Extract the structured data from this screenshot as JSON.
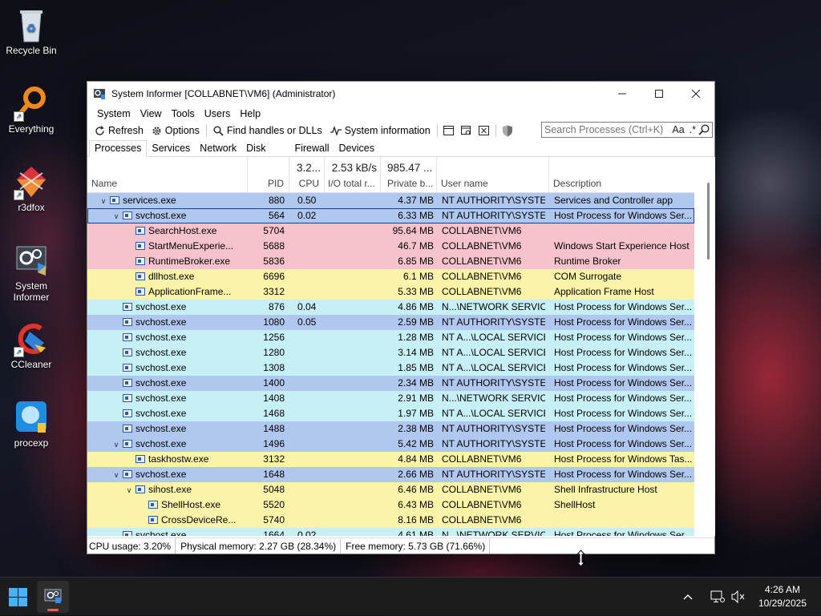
{
  "desktop": {
    "icons": [
      {
        "label": "Recycle Bin"
      },
      {
        "label": "Everything"
      },
      {
        "label": "r3dfox"
      },
      {
        "label": "System Informer"
      },
      {
        "label": "CCleaner"
      },
      {
        "label": "procexp"
      }
    ]
  },
  "window": {
    "title": "System Informer [COLLABNET\\VM6] (Administrator)",
    "menu": [
      "System",
      "View",
      "Tools",
      "Users",
      "Help"
    ],
    "toolbar": {
      "refresh": "Refresh",
      "options": "Options",
      "find": "Find handles or DLLs",
      "sysinfo": "System information"
    },
    "search": {
      "placeholder": "Search Processes (Ctrl+K)",
      "case_toggle": "Aa",
      "regex_toggle": ".*"
    },
    "tabs": [
      "Processes",
      "Services",
      "Network",
      "Disk",
      "Firewall",
      "Devices"
    ],
    "columns": {
      "name": "Name",
      "pid": "PID",
      "cpu": "CPU",
      "cpu_total": "3.2...",
      "io": "I/O total r...",
      "io_total": "2.53 kB/s",
      "priv": "Private b...",
      "priv_total": "985.47 ...",
      "user": "User name",
      "desc": "Description"
    },
    "processes": [
      {
        "name": "services.exe",
        "pid": "880",
        "cpu": "0.50",
        "priv": "4.37 MB",
        "user": "NT AUTHORITY\\SYSTEM",
        "desc": "Services and Controller app",
        "level": 1,
        "expanded": true,
        "color": "#b0c8f0"
      },
      {
        "name": "svchost.exe",
        "pid": "564",
        "cpu": "0.02",
        "priv": "6.33 MB",
        "user": "NT AUTHORITY\\SYSTEM",
        "desc": "Host Process for Windows Ser...",
        "level": 2,
        "expanded": true,
        "color": "#b0c8f0",
        "selected": true
      },
      {
        "name": "SearchHost.exe",
        "pid": "5704",
        "cpu": "",
        "priv": "95.64 MB",
        "user": "COLLABNET\\VM6",
        "desc": "",
        "level": 3,
        "color": "#f6c2cc"
      },
      {
        "name": "StartMenuExperie...",
        "pid": "5688",
        "cpu": "",
        "priv": "46.7 MB",
        "user": "COLLABNET\\VM6",
        "desc": "Windows Start Experience Host",
        "level": 3,
        "color": "#f6c2cc"
      },
      {
        "name": "RuntimeBroker.exe",
        "pid": "5836",
        "cpu": "",
        "priv": "6.85 MB",
        "user": "COLLABNET\\VM6",
        "desc": "Runtime Broker",
        "level": 3,
        "color": "#f6c2cc"
      },
      {
        "name": "dllhost.exe",
        "pid": "6696",
        "cpu": "",
        "priv": "6.1 MB",
        "user": "COLLABNET\\VM6",
        "desc": "COM Surrogate",
        "level": 3,
        "color": "#fbf4a8"
      },
      {
        "name": "ApplicationFrame...",
        "pid": "3312",
        "cpu": "",
        "priv": "5.33 MB",
        "user": "COLLABNET\\VM6",
        "desc": "Application Frame Host",
        "level": 3,
        "color": "#fbf4a8"
      },
      {
        "name": "svchost.exe",
        "pid": "876",
        "cpu": "0.04",
        "priv": "4.86 MB",
        "user": "N...\\NETWORK SERVICE",
        "desc": "Host Process for Windows Ser...",
        "level": 2,
        "color": "#c6f0f6"
      },
      {
        "name": "svchost.exe",
        "pid": "1080",
        "cpu": "0.05",
        "priv": "2.59 MB",
        "user": "NT AUTHORITY\\SYSTEM",
        "desc": "Host Process for Windows Ser...",
        "level": 2,
        "color": "#b0c8f0"
      },
      {
        "name": "svchost.exe",
        "pid": "1256",
        "cpu": "",
        "priv": "1.28 MB",
        "user": "NT A...\\LOCAL SERVICE",
        "desc": "Host Process for Windows Ser...",
        "level": 2,
        "color": "#c6f0f6"
      },
      {
        "name": "svchost.exe",
        "pid": "1280",
        "cpu": "",
        "priv": "3.14 MB",
        "user": "NT A...\\LOCAL SERVICE",
        "desc": "Host Process for Windows Ser...",
        "level": 2,
        "color": "#c6f0f6"
      },
      {
        "name": "svchost.exe",
        "pid": "1308",
        "cpu": "",
        "priv": "1.85 MB",
        "user": "NT A...\\LOCAL SERVICE",
        "desc": "Host Process for Windows Ser...",
        "level": 2,
        "color": "#c6f0f6"
      },
      {
        "name": "svchost.exe",
        "pid": "1400",
        "cpu": "",
        "priv": "2.34 MB",
        "user": "NT AUTHORITY\\SYSTEM",
        "desc": "Host Process for Windows Ser...",
        "level": 2,
        "color": "#b0c8f0"
      },
      {
        "name": "svchost.exe",
        "pid": "1408",
        "cpu": "",
        "priv": "2.91 MB",
        "user": "N...\\NETWORK SERVICE",
        "desc": "Host Process for Windows Ser...",
        "level": 2,
        "color": "#c6f0f6"
      },
      {
        "name": "svchost.exe",
        "pid": "1468",
        "cpu": "",
        "priv": "1.97 MB",
        "user": "NT A...\\LOCAL SERVICE",
        "desc": "Host Process for Windows Ser...",
        "level": 2,
        "color": "#c6f0f6"
      },
      {
        "name": "svchost.exe",
        "pid": "1488",
        "cpu": "",
        "priv": "2.38 MB",
        "user": "NT AUTHORITY\\SYSTEM",
        "desc": "Host Process for Windows Ser...",
        "level": 2,
        "color": "#b0c8f0"
      },
      {
        "name": "svchost.exe",
        "pid": "1496",
        "cpu": "",
        "priv": "5.42 MB",
        "user": "NT AUTHORITY\\SYSTEM",
        "desc": "Host Process for Windows Ser...",
        "level": 2,
        "expanded": true,
        "color": "#b0c8f0"
      },
      {
        "name": "taskhostw.exe",
        "pid": "3132",
        "cpu": "",
        "priv": "4.84 MB",
        "user": "COLLABNET\\VM6",
        "desc": "Host Process for Windows Tas...",
        "level": 3,
        "color": "#fbf4a8"
      },
      {
        "name": "svchost.exe",
        "pid": "1648",
        "cpu": "",
        "priv": "2.66 MB",
        "user": "NT AUTHORITY\\SYSTEM",
        "desc": "Host Process for Windows Ser...",
        "level": 2,
        "expanded": true,
        "color": "#b0c8f0"
      },
      {
        "name": "sihost.exe",
        "pid": "5048",
        "cpu": "",
        "priv": "6.46 MB",
        "user": "COLLABNET\\VM6",
        "desc": "Shell Infrastructure Host",
        "level": 3,
        "expanded": true,
        "color": "#fbf4a8"
      },
      {
        "name": "ShellHost.exe",
        "pid": "5520",
        "cpu": "",
        "priv": "6.43 MB",
        "user": "COLLABNET\\VM6",
        "desc": "ShellHost",
        "level": 4,
        "color": "#fbf4a8"
      },
      {
        "name": "CrossDeviceRe...",
        "pid": "5740",
        "cpu": "",
        "priv": "8.16 MB",
        "user": "COLLABNET\\VM6",
        "desc": "",
        "level": 4,
        "color": "#fbf4a8"
      },
      {
        "name": "svchost.exe",
        "pid": "1664",
        "cpu": "0.02",
        "priv": "4.61 MB",
        "user": "N...\\NETWORK SERVICE",
        "desc": "Host Process for Windows Ser...",
        "level": 2,
        "color": "#c6f0f6"
      }
    ],
    "status": {
      "cpu": "CPU usage: 3.20%",
      "physical": "Physical memory: 2.27 GB (28.34%)",
      "free": "Free memory: 5.73 GB (71.66%)"
    }
  },
  "taskbar": {
    "time": "4:26 AM",
    "date": "10/29/2025"
  }
}
